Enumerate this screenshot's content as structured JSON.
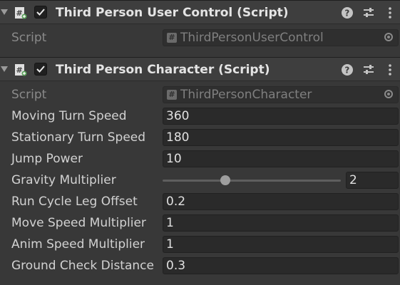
{
  "components": [
    {
      "title": "Third Person User Control (Script)",
      "enabled": true,
      "script_label": "Script",
      "script_value": "ThirdPersonUserControl",
      "script_hash": "#"
    },
    {
      "title": "Third Person Character (Script)",
      "enabled": true,
      "script_label": "Script",
      "script_value": "ThirdPersonCharacter",
      "script_hash": "#",
      "properties": [
        {
          "label": "Moving Turn Speed",
          "value": "360"
        },
        {
          "label": "Stationary Turn Speed",
          "value": "180"
        },
        {
          "label": "Jump Power",
          "value": "10"
        },
        {
          "label": "Gravity Multiplier",
          "value": "2",
          "slider_fraction": 0.35
        },
        {
          "label": "Run Cycle Leg Offset",
          "value": "0.2"
        },
        {
          "label": "Move Speed Multiplier",
          "value": "1"
        },
        {
          "label": "Anim Speed Multiplier",
          "value": "1"
        },
        {
          "label": "Ground Check Distance",
          "value": "0.3"
        }
      ]
    }
  ],
  "icons": {
    "foldout": "foldout-arrow-icon",
    "script": "csharp-script-icon",
    "help": "help-icon",
    "presets": "presets-icon",
    "menu": "kebab-menu-icon",
    "object_picker": "object-picker-icon"
  },
  "colors": {
    "background": "#383838",
    "header": "#3e3e3e",
    "field": "#2a2a2a",
    "text": "#d2d2d2"
  }
}
